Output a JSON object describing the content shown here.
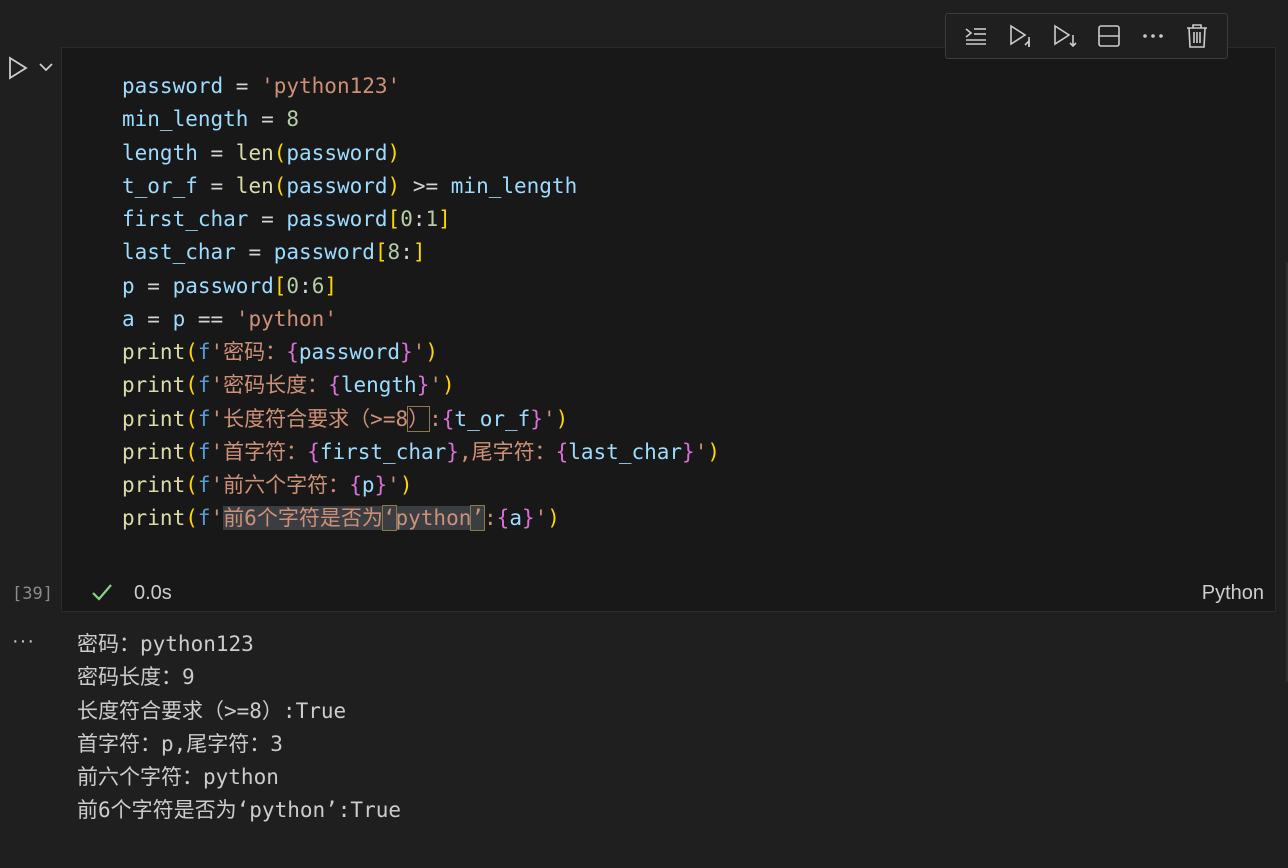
{
  "toolbar": {
    "icons": [
      "execute-above-icon",
      "run-by-line-icon",
      "run-above-icon",
      "split-cell-icon",
      "more-icon",
      "delete-cell-icon"
    ]
  },
  "cell": {
    "execution_count": "[39]",
    "status_time": "0.0s",
    "language": "Python",
    "code_lines": [
      [
        {
          "t": "password",
          "c": "v"
        },
        {
          "t": " = ",
          "c": "op"
        },
        {
          "t": "'python123'",
          "c": "s"
        }
      ],
      [
        {
          "t": "min_length",
          "c": "v"
        },
        {
          "t": " = ",
          "c": "op"
        },
        {
          "t": "8",
          "c": "n"
        }
      ],
      [
        {
          "t": "length",
          "c": "v"
        },
        {
          "t": " = ",
          "c": "op"
        },
        {
          "t": "len",
          "c": "f"
        },
        {
          "t": "(",
          "c": "b1"
        },
        {
          "t": "password",
          "c": "v"
        },
        {
          "t": ")",
          "c": "b1"
        }
      ],
      [
        {
          "t": "t_or_f",
          "c": "v"
        },
        {
          "t": " = ",
          "c": "op"
        },
        {
          "t": "len",
          "c": "f"
        },
        {
          "t": "(",
          "c": "b1"
        },
        {
          "t": "password",
          "c": "v"
        },
        {
          "t": ")",
          "c": "b1"
        },
        {
          "t": " >= ",
          "c": "op"
        },
        {
          "t": "min_length",
          "c": "v"
        }
      ],
      [
        {
          "t": "first_char",
          "c": "v"
        },
        {
          "t": " = ",
          "c": "op"
        },
        {
          "t": "password",
          "c": "v"
        },
        {
          "t": "[",
          "c": "b1"
        },
        {
          "t": "0",
          "c": "n"
        },
        {
          "t": ":",
          "c": "op"
        },
        {
          "t": "1",
          "c": "n"
        },
        {
          "t": "]",
          "c": "b1"
        }
      ],
      [
        {
          "t": "last_char",
          "c": "v"
        },
        {
          "t": " = ",
          "c": "op"
        },
        {
          "t": "password",
          "c": "v"
        },
        {
          "t": "[",
          "c": "b1"
        },
        {
          "t": "8",
          "c": "n"
        },
        {
          "t": ":",
          "c": "op"
        },
        {
          "t": "]",
          "c": "b1"
        }
      ],
      [
        {
          "t": "p",
          "c": "v"
        },
        {
          "t": " = ",
          "c": "op"
        },
        {
          "t": "password",
          "c": "v"
        },
        {
          "t": "[",
          "c": "b1"
        },
        {
          "t": "0",
          "c": "n"
        },
        {
          "t": ":",
          "c": "op"
        },
        {
          "t": "6",
          "c": "n"
        },
        {
          "t": "]",
          "c": "b1"
        }
      ],
      [
        {
          "t": "a",
          "c": "v"
        },
        {
          "t": " = ",
          "c": "op"
        },
        {
          "t": "p",
          "c": "v"
        },
        {
          "t": " == ",
          "c": "op"
        },
        {
          "t": "'python'",
          "c": "s"
        }
      ],
      [
        {
          "t": "print",
          "c": "f"
        },
        {
          "t": "(",
          "c": "b1"
        },
        {
          "t": "f",
          "c": "k"
        },
        {
          "t": "'密码：",
          "c": "s"
        },
        {
          "t": "{",
          "c": "b2"
        },
        {
          "t": "password",
          "c": "v"
        },
        {
          "t": "}",
          "c": "b2"
        },
        {
          "t": "'",
          "c": "s"
        },
        {
          "t": ")",
          "c": "b1"
        }
      ],
      [
        {
          "t": "print",
          "c": "f"
        },
        {
          "t": "(",
          "c": "b1"
        },
        {
          "t": "f",
          "c": "k"
        },
        {
          "t": "'密码长度：",
          "c": "s"
        },
        {
          "t": "{",
          "c": "b2"
        },
        {
          "t": "length",
          "c": "v"
        },
        {
          "t": "}",
          "c": "b2"
        },
        {
          "t": "'",
          "c": "s"
        },
        {
          "t": ")",
          "c": "b1"
        }
      ],
      [
        {
          "t": "print",
          "c": "f"
        },
        {
          "t": "(",
          "c": "b1"
        },
        {
          "t": "f",
          "c": "k"
        },
        {
          "t": "'长度符合要求（>=8",
          "c": "s"
        },
        {
          "t": "）",
          "c": "s cursor-box"
        },
        {
          "t": ":",
          "c": "s"
        },
        {
          "t": "{",
          "c": "b2"
        },
        {
          "t": "t_or_f",
          "c": "v"
        },
        {
          "t": "}",
          "c": "b2"
        },
        {
          "t": "'",
          "c": "s"
        },
        {
          "t": ")",
          "c": "b1"
        }
      ],
      [
        {
          "t": "print",
          "c": "f"
        },
        {
          "t": "(",
          "c": "b1"
        },
        {
          "t": "f",
          "c": "k"
        },
        {
          "t": "'首字符：",
          "c": "s"
        },
        {
          "t": "{",
          "c": "b2"
        },
        {
          "t": "first_char",
          "c": "v"
        },
        {
          "t": "}",
          "c": "b2"
        },
        {
          "t": ",尾字符：",
          "c": "s"
        },
        {
          "t": "{",
          "c": "b2"
        },
        {
          "t": "last_char",
          "c": "v"
        },
        {
          "t": "}",
          "c": "b2"
        },
        {
          "t": "'",
          "c": "s"
        },
        {
          "t": ")",
          "c": "b1"
        }
      ],
      [
        {
          "t": "print",
          "c": "f"
        },
        {
          "t": "(",
          "c": "b1"
        },
        {
          "t": "f",
          "c": "k"
        },
        {
          "t": "'前六个字符：",
          "c": "s"
        },
        {
          "t": "{",
          "c": "b2"
        },
        {
          "t": "p",
          "c": "v"
        },
        {
          "t": "}",
          "c": "b2"
        },
        {
          "t": "'",
          "c": "s"
        },
        {
          "t": ")",
          "c": "b1"
        }
      ],
      [
        {
          "t": "print",
          "c": "f"
        },
        {
          "t": "(",
          "c": "b1"
        },
        {
          "t": "f",
          "c": "k"
        },
        {
          "t": "'",
          "c": "s"
        },
        {
          "t": "前6个字符是否为",
          "c": "s hl"
        },
        {
          "t": "‘",
          "c": "s hl cursor-box"
        },
        {
          "t": "python",
          "c": "s hl"
        },
        {
          "t": "’",
          "c": "s hl cursor-box"
        },
        {
          "t": ":",
          "c": "s"
        },
        {
          "t": "{",
          "c": "b2"
        },
        {
          "t": "a",
          "c": "v"
        },
        {
          "t": "}",
          "c": "b2"
        },
        {
          "t": "'",
          "c": "s"
        },
        {
          "t": ")",
          "c": "b1"
        }
      ]
    ]
  },
  "output": {
    "more_label": "···",
    "lines": [
      "密码：python123",
      "密码长度：9",
      "长度符合要求（>=8）:True",
      "首字符：p,尾字符：3",
      "前六个字符：python",
      "前6个字符是否为‘python’:True"
    ]
  },
  "colors": {
    "background": "#1f1f1f",
    "editor": "#181818",
    "check": "#89d185"
  }
}
